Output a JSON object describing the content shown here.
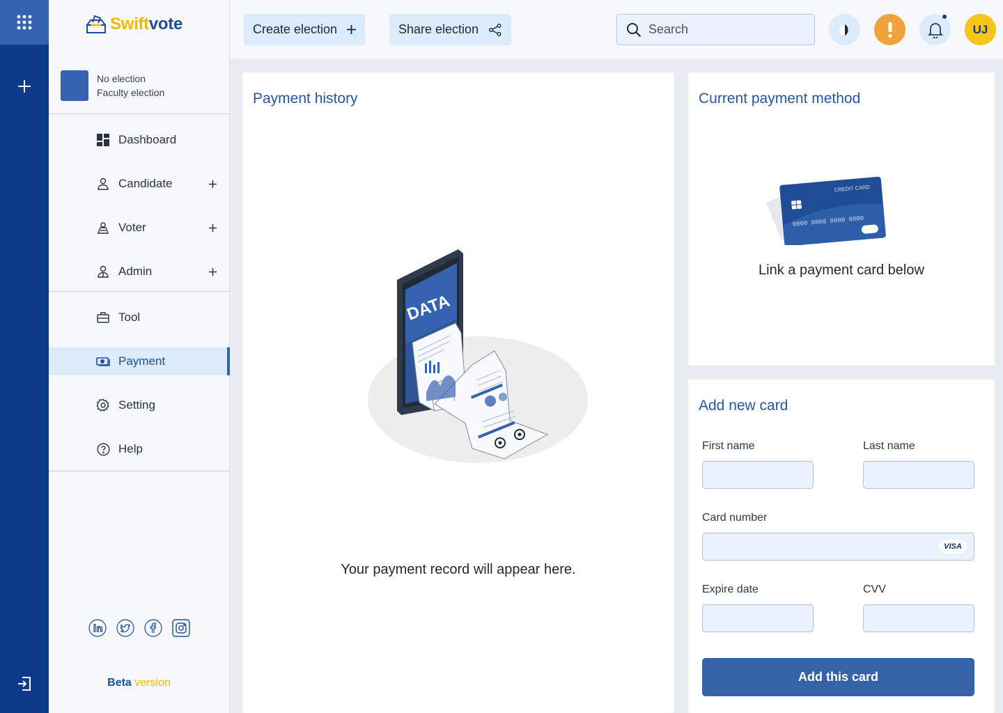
{
  "brand": {
    "name_part1": "Swift",
    "name_part2": "vote"
  },
  "election": {
    "title": "No election",
    "subtitle": "Faculty election"
  },
  "nav": {
    "dashboard": "Dashboard",
    "candidate": "Candidate",
    "voter": "Voter",
    "admin": "Admin",
    "tool": "Tool",
    "payment": "Payment",
    "setting": "Setting",
    "help": "Help"
  },
  "footer": {
    "beta_word": "Beta",
    "version_word": "version"
  },
  "toolbar": {
    "create_label": "Create election",
    "share_label": "Share election",
    "search_placeholder": "Search",
    "avatar_initials": "UJ"
  },
  "payment_history": {
    "title": "Payment history",
    "illustration_label": "DATA",
    "empty_message": "Your payment record will appear here."
  },
  "current_method": {
    "title": "Current payment method",
    "card_label": "CREDIT CARD",
    "card_number": "0000  0000  0000  0000",
    "message": "Link a payment card below"
  },
  "add_card": {
    "title": "Add new card",
    "first_name_label": "First name",
    "last_name_label": "Last name",
    "card_number_label": "Card number",
    "card_brand": "VISA",
    "expire_label": "Expire date",
    "cvv_label": "CVV",
    "submit_label": "Add this card"
  },
  "colors": {
    "rail": "#0d3a8a",
    "accent": "#3563b0",
    "brand_yellow": "#f5b800",
    "warning": "#f0a33a",
    "avatar_bg": "#f5c518",
    "active_nav_bg": "#dcebfa"
  },
  "icons": [
    "apps-grid-icon",
    "plus-icon",
    "logout-icon",
    "dashboard-icon",
    "person-icon",
    "voter-icon",
    "admin-icon",
    "toolbox-icon",
    "payment-icon",
    "gear-icon",
    "help-icon",
    "linkedin-icon",
    "twitter-icon",
    "facebook-icon",
    "instagram-icon",
    "share-icon",
    "search-icon",
    "moon-icon",
    "alert-icon",
    "bell-icon"
  ]
}
